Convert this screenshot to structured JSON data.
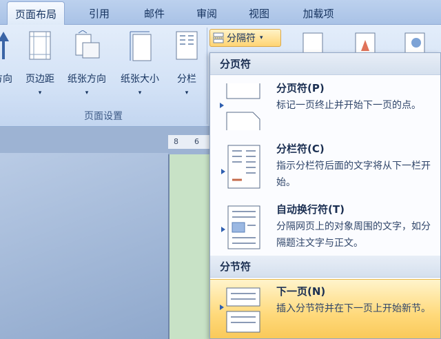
{
  "tabs": [
    {
      "label": "页面布局",
      "active": true
    },
    {
      "label": "引用"
    },
    {
      "label": "邮件"
    },
    {
      "label": "审阅"
    },
    {
      "label": "视图"
    },
    {
      "label": "加载项"
    }
  ],
  "ribbon": {
    "buttons": [
      {
        "label": "方向"
      },
      {
        "label": "页边距"
      },
      {
        "label": "纸张方向"
      },
      {
        "label": "纸张大小"
      },
      {
        "label": "分栏"
      }
    ],
    "group_label": "页面设置",
    "breaks_button": "分隔符"
  },
  "ruler": {
    "n1": "8",
    "n2": "6"
  },
  "menu": {
    "page_breaks_header": "分页符",
    "section_breaks_header": "分节符",
    "items": [
      {
        "title": "分页符(P)",
        "desc": "标记一页终止并开始下一页的点。"
      },
      {
        "title": "分栏符(C)",
        "desc": "指示分栏符后面的文字将从下一栏开始。"
      },
      {
        "title": "自动换行符(T)",
        "desc": "分隔网页上的对象周围的文字，如分隔题注文字与正文。"
      },
      {
        "title": "下一页(N)",
        "desc": "插入分节符并在下一页上开始新节。"
      }
    ]
  },
  "colors": {
    "accent": "#ffd473",
    "ribbon": "#d3e2f6"
  }
}
